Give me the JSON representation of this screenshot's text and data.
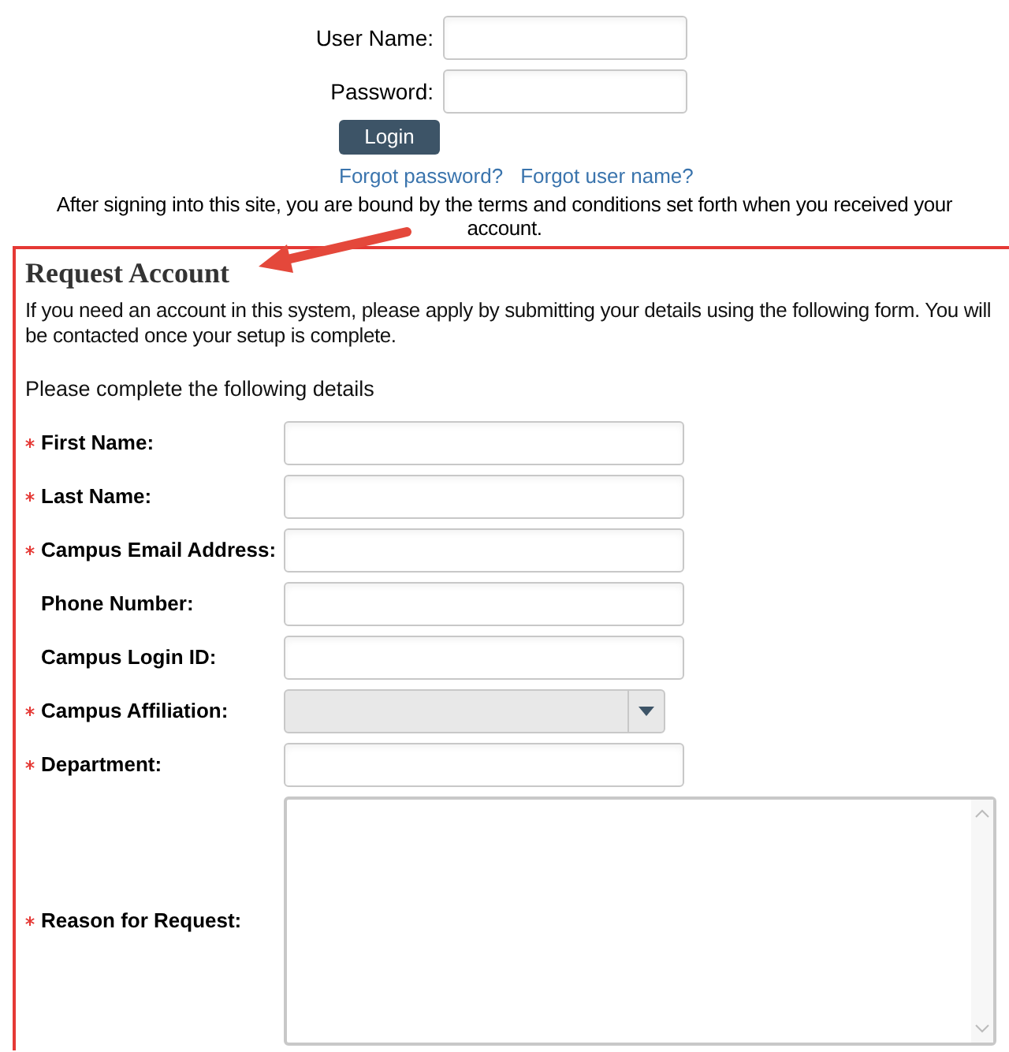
{
  "login": {
    "fields": [
      {
        "label": "User Name:"
      },
      {
        "label": "Password:"
      }
    ],
    "button": "Login",
    "links": [
      "Forgot password?",
      "Forgot user name?"
    ],
    "notice": "After signing into this site, you are bound by the terms and conditions set forth when you received your account."
  },
  "request_account": {
    "title": "Request Account",
    "intro": "If you need an account in this system, please apply by submitting your details using the following form. You will be contacted once your setup is complete.",
    "instruction": "Please complete the following details",
    "fields": [
      {
        "label": "First Name:",
        "required": true,
        "kind": "text"
      },
      {
        "label": "Last Name:",
        "required": true,
        "kind": "text"
      },
      {
        "label": "Campus Email Address:",
        "required": true,
        "kind": "text"
      },
      {
        "label": "Phone Number:",
        "required": false,
        "kind": "text"
      },
      {
        "label": "Campus Login ID:",
        "required": false,
        "kind": "text"
      },
      {
        "label": "Campus Affiliation:",
        "required": true,
        "kind": "select"
      },
      {
        "label": "Department:",
        "required": true,
        "kind": "text"
      },
      {
        "label": "Reason for Request:",
        "required": true,
        "kind": "textarea"
      }
    ]
  }
}
